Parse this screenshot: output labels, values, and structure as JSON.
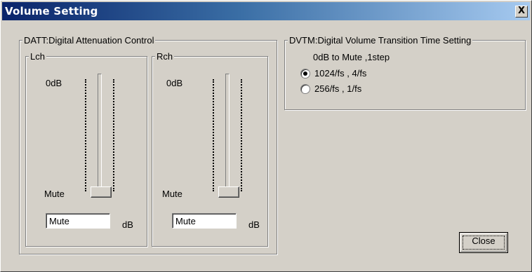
{
  "window": {
    "title": "Volume Setting",
    "close_glyph": "X"
  },
  "datt": {
    "legend": "DATT:Digital Attenuation Control",
    "lch": {
      "legend": "Lch",
      "top_label": "0dB",
      "bottom_label": "Mute",
      "level": 0,
      "value": "Mute",
      "unit": "dB"
    },
    "rch": {
      "legend": "Rch",
      "top_label": "0dB",
      "bottom_label": "Mute",
      "level": 0,
      "value": "Mute",
      "unit": "dB"
    }
  },
  "dvtm": {
    "legend": "DVTM:Digital Volume Transition Time Setting",
    "subtitle": "0dB to Mute ,1step",
    "options": [
      {
        "label": "1024/fs , 4/fs",
        "checked": true
      },
      {
        "label": "256/fs , 1/fs",
        "checked": false
      }
    ]
  },
  "buttons": {
    "close": "Close"
  }
}
